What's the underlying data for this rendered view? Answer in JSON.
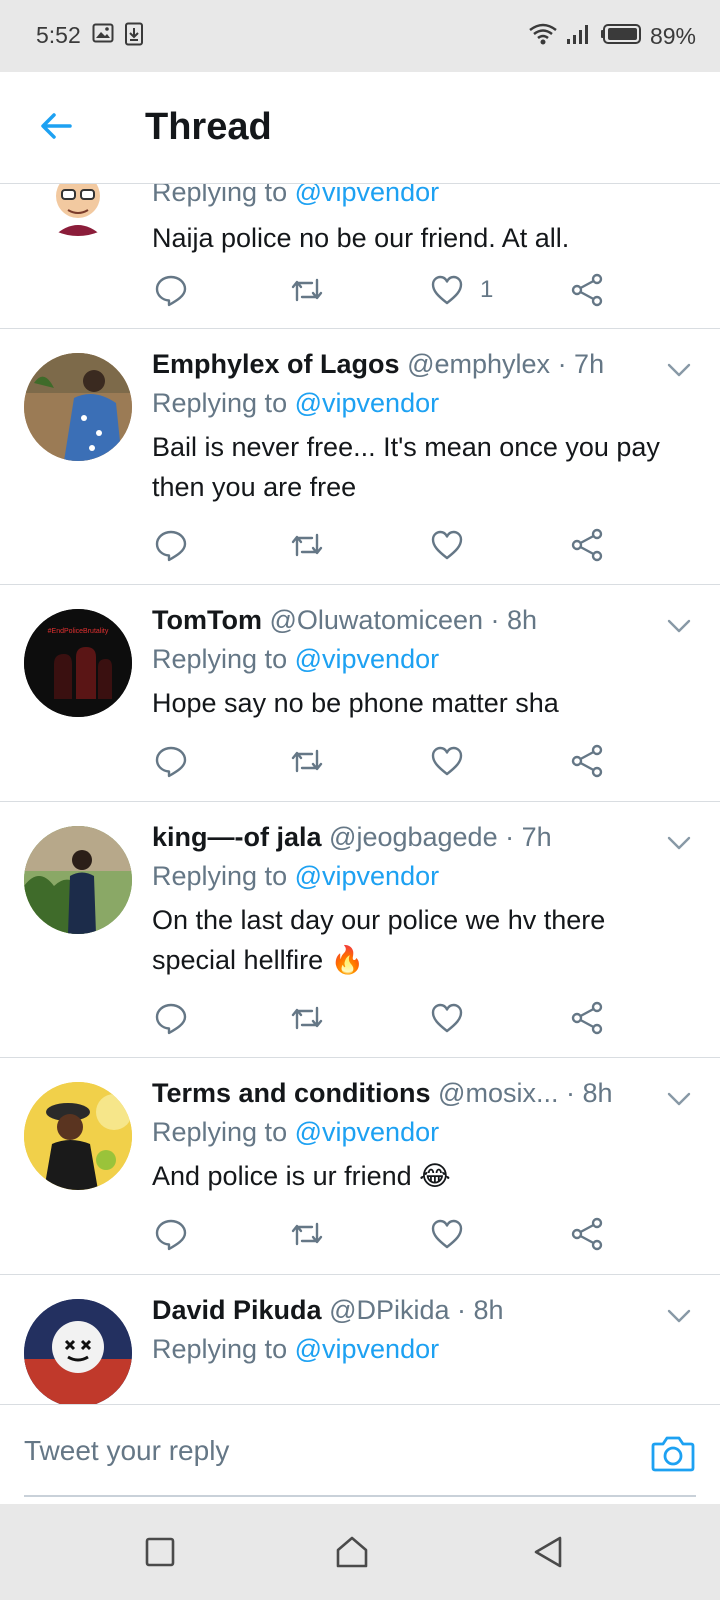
{
  "status_bar": {
    "time": "5:52",
    "battery": "89%",
    "icons": [
      "image-icon",
      "download-icon",
      "wifi-icon",
      "signal-icon",
      "battery-icon"
    ]
  },
  "header": {
    "title": "Thread",
    "back_icon": "arrow-left-icon"
  },
  "colors": {
    "accent": "#1da1f2",
    "text": "#14171a",
    "secondary": "#657786",
    "divider": "#d9dde1"
  },
  "tweets": [
    {
      "name": "",
      "handle": "",
      "time": "",
      "replying_prefix": "Replying to",
      "replying_to": "@vipvendor",
      "text": "Naija police no be our friend. At all.",
      "likes": "1"
    },
    {
      "name": "Emphylex of Lagos",
      "handle": "@emphylex",
      "time": "· 7h",
      "replying_prefix": "Replying to",
      "replying_to": "@vipvendor",
      "text": "Bail is never free... It's mean once you pay then you are free",
      "likes": ""
    },
    {
      "name": "TomTom",
      "handle": "@Oluwatomiceen",
      "time": "· 8h",
      "replying_prefix": "Replying to",
      "replying_to": "@vipvendor",
      "text": "Hope say no be phone matter sha",
      "likes": "",
      "avatar_text": "#EndPoliceBrutality"
    },
    {
      "name": "king—-of jala",
      "handle": "@jeogbagede",
      "time": "· 7h",
      "replying_prefix": "Replying to",
      "replying_to": "@vipvendor",
      "text": "On the last day our police we hv there special hellfire 🔥",
      "likes": ""
    },
    {
      "name": "Terms and conditions",
      "handle": "@mosix...",
      "time": "· 8h",
      "replying_prefix": "Replying to",
      "replying_to": "@vipvendor",
      "text": "And police is ur friend 😂",
      "likes": ""
    },
    {
      "name": "David Pikuda",
      "handle": "@DPikida",
      "time": "· 8h",
      "replying_prefix": "Replying to",
      "replying_to": "@vipvendor",
      "text": "",
      "likes": ""
    }
  ],
  "composer": {
    "placeholder": "Tweet your reply",
    "camera_icon": "camera-icon"
  },
  "navbar": {
    "icons": [
      "recents-square-icon",
      "home-icon",
      "back-triangle-icon"
    ]
  }
}
